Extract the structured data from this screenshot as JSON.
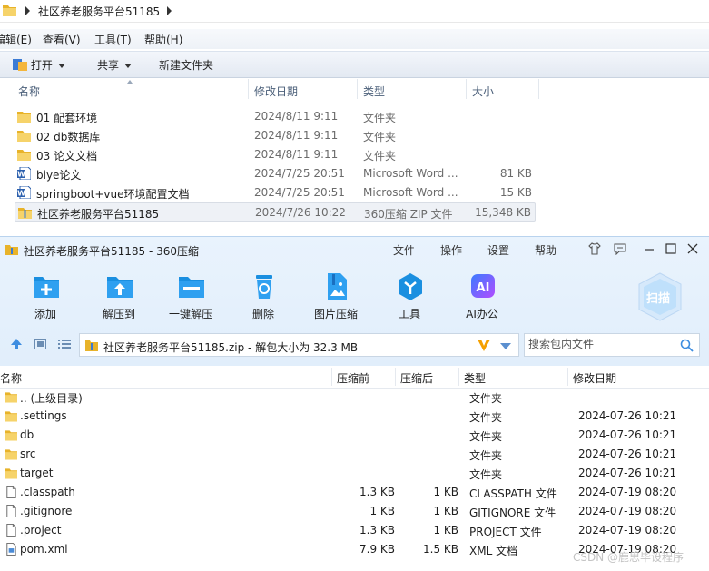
{
  "explorer": {
    "path": "社区养老服务平台51185",
    "menu": [
      "编辑(E)",
      "查看(V)",
      "工具(T)",
      "帮助(H)"
    ],
    "cmd": {
      "open": "打开",
      "share": "共享",
      "new_folder": "新建文件夹"
    },
    "columns": [
      "名称",
      "修改日期",
      "类型",
      "大小"
    ],
    "rows": [
      {
        "name": "01 配套环境",
        "date": "2024/8/11 9:11",
        "type": "文件夹",
        "size": "",
        "icon": "folder-icon"
      },
      {
        "name": "02 db数据库",
        "date": "2024/8/11 9:11",
        "type": "文件夹",
        "size": "",
        "icon": "folder-icon"
      },
      {
        "name": "03 论文文档",
        "date": "2024/8/11 9:11",
        "type": "文件夹",
        "size": "",
        "icon": "folder-icon"
      },
      {
        "name": "biye论文",
        "date": "2024/7/25 20:51",
        "type": "Microsoft Word ...",
        "size": "81 KB",
        "icon": "word-doc-icon"
      },
      {
        "name": "springboot+vue环境配置文档",
        "date": "2024/7/25 20:51",
        "type": "Microsoft Word ...",
        "size": "15 KB",
        "icon": "word-doc-icon"
      },
      {
        "name": "社区养老服务平台51185",
        "date": "2024/7/26 10:22",
        "type": "360压缩 ZIP 文件",
        "size": "15,348 KB",
        "icon": "zip-archive-icon"
      }
    ]
  },
  "zip": {
    "title": "社区养老服务平台51185 - 360压缩",
    "menu": [
      "文件",
      "操作",
      "设置",
      "帮助"
    ],
    "tools": [
      "添加",
      "解压到",
      "一键解压",
      "删除",
      "图片压缩",
      "工具",
      "AI办公"
    ],
    "scan_label": "扫描",
    "address": "社区养老服务平台51185.zip - 解包大小为 32.3 MB",
    "search_placeholder": "搜索包内文件",
    "columns": [
      "名称",
      "压缩前",
      "压缩后",
      "类型",
      "修改日期"
    ],
    "rows": [
      {
        "name": ".. (上级目录)",
        "before": "",
        "after": "",
        "type": "文件夹",
        "date": "",
        "icon": "folder-icon"
      },
      {
        "name": ".settings",
        "before": "",
        "after": "",
        "type": "文件夹",
        "date": "2024-07-26 10:21",
        "icon": "folder-icon"
      },
      {
        "name": "db",
        "before": "",
        "after": "",
        "type": "文件夹",
        "date": "2024-07-26 10:21",
        "icon": "folder-icon"
      },
      {
        "name": "src",
        "before": "",
        "after": "",
        "type": "文件夹",
        "date": "2024-07-26 10:21",
        "icon": "folder-icon"
      },
      {
        "name": "target",
        "before": "",
        "after": "",
        "type": "文件夹",
        "date": "2024-07-26 10:21",
        "icon": "folder-icon"
      },
      {
        "name": ".classpath",
        "before": "1.3 KB",
        "after": "1 KB",
        "type": "CLASSPATH 文件",
        "date": "2024-07-19 08:20",
        "icon": "file-icon"
      },
      {
        "name": ".gitignore",
        "before": "1 KB",
        "after": "1 KB",
        "type": "GITIGNORE 文件",
        "date": "2024-07-19 08:20",
        "icon": "file-icon"
      },
      {
        "name": ".project",
        "before": "1.3 KB",
        "after": "1 KB",
        "type": "PROJECT 文件",
        "date": "2024-07-19 08:20",
        "icon": "file-icon"
      },
      {
        "name": "pom.xml",
        "before": "7.9 KB",
        "after": "1.5 KB",
        "type": "XML 文档",
        "date": "2024-07-19 08:20",
        "icon": "xml-file-icon"
      }
    ]
  },
  "watermark": "CSDN @鹿思毕设程序",
  "colors": {
    "accent_blue": "#1a8fe0",
    "folder_yellow": "#f2c23c",
    "toolbar_bg": "#e6f1fc",
    "ai_purple": "#7a4dff"
  }
}
